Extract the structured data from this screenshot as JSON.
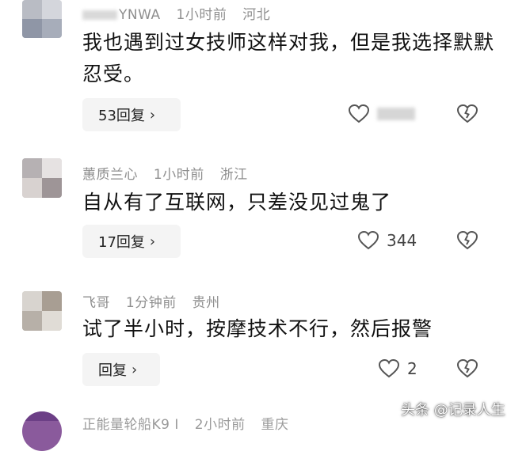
{
  "comments": [
    {
      "username": "YNWA",
      "time": "1小时前",
      "location": "河北",
      "text": "我也遇到过女技师这样对我，但是我选择默默忍受。",
      "reply_label": "53回复",
      "like_count": ""
    },
    {
      "username": "蕙质兰心",
      "time": "1小时前",
      "location": "浙江",
      "text": "自从有了互联网，只差没见过鬼了",
      "reply_label": "17回复",
      "like_count": "344"
    },
    {
      "username": "飞哥",
      "time": "1分钟前",
      "location": "贵州",
      "text": "试了半小时，按摩技术不行，然后报警",
      "reply_label": "回复",
      "like_count": "2"
    },
    {
      "username": "正能量轮船K9 I",
      "time": "2小时前",
      "location": "重庆"
    }
  ],
  "watermark": "头条 @记录人生",
  "icons": {
    "like": "heart-outline-icon",
    "dislike": "broken-heart-icon",
    "chevron": "chevron-right-icon"
  },
  "colors": {
    "meta_text": "#8f8f8f",
    "reply_bg": "#f4f4f4"
  }
}
